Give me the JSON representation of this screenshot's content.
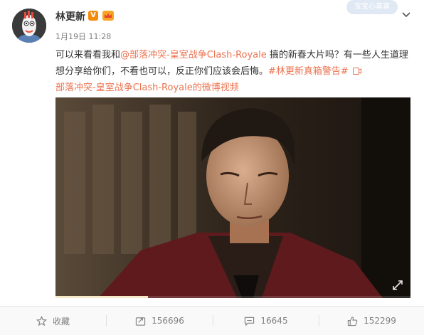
{
  "post": {
    "author": "林更新",
    "verified_badge": "V",
    "timestamp": "1月19日 11:28",
    "stamp": "宝宝心塞塞",
    "text_1": "可以来看看我和",
    "mention": "@部落冲突-皇室战争Clash-Royale",
    "text_2": " 搞的新春大片吗？有一些人生道理想分享给你们，不看也可以，反正你们应该会后悔。",
    "hashtag": "#林更新真箱警告#",
    "video_link": "部落冲突-皇室战争Clash-Royale的微博视频"
  },
  "video": {
    "progress": 0.26
  },
  "footer": {
    "favorite_label": "收藏",
    "repost_count": "156696",
    "comment_count": "16645",
    "like_count": "152299"
  },
  "colors": {
    "link": "#eb7350",
    "badge": "#f78a09"
  },
  "icons": [
    "crown-icon",
    "chevron-down-icon",
    "video-icon",
    "fullscreen-icon",
    "star-icon",
    "repost-icon",
    "comment-icon",
    "like-icon"
  ]
}
